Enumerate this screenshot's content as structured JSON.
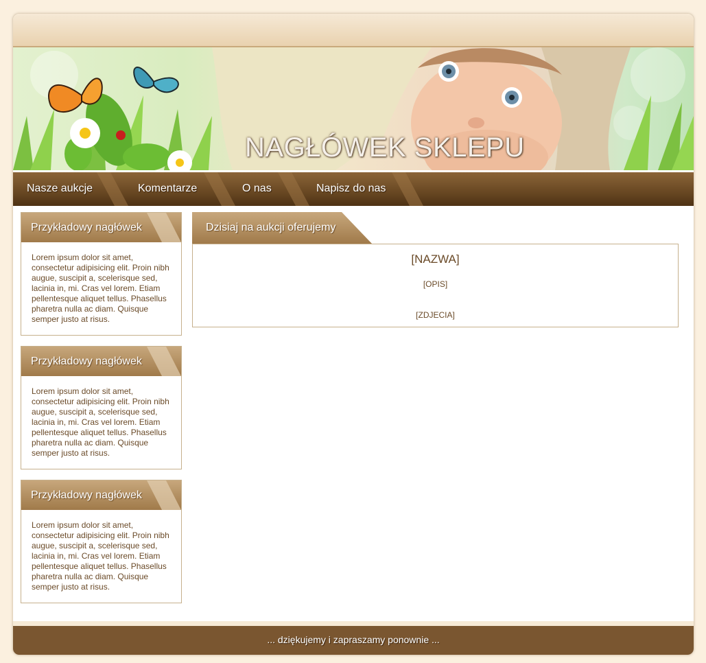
{
  "banner": {
    "title": "NAGŁÓWEK SKLEPU"
  },
  "nav": {
    "items": [
      {
        "label": "Nasze aukcje"
      },
      {
        "label": "Komentarze"
      },
      {
        "label": "O nas"
      },
      {
        "label": "Napisz do nas"
      }
    ]
  },
  "sidebar": {
    "boxes": [
      {
        "heading": "Przykładowy nagłówek",
        "text": "Lorem ipsum dolor sit amet, consectetur adipisicing elit. Proin nibh augue, suscipit a, scelerisque sed, lacinia in, mi. Cras vel lorem. Etiam pellentesque aliquet tellus. Phasellus pharetra nulla ac diam. Quisque semper justo at risus."
      },
      {
        "heading": "Przykładowy nagłówek",
        "text": "Lorem ipsum dolor sit amet, consectetur adipisicing elit. Proin nibh augue, suscipit a, scelerisque sed, lacinia in, mi. Cras vel lorem. Etiam pellentesque aliquet tellus. Phasellus pharetra nulla ac diam. Quisque semper justo at risus."
      },
      {
        "heading": "Przykładowy nagłówek",
        "text": "Lorem ipsum dolor sit amet, consectetur adipisicing elit. Proin nibh augue, suscipit a, scelerisque sed, lacinia in, mi. Cras vel lorem. Etiam pellentesque aliquet tellus. Phasellus pharetra nulla ac diam. Quisque semper justo at risus."
      }
    ]
  },
  "main": {
    "tab_label": "Dzisiaj na aukcji oferujemy",
    "name": "[NAZWA]",
    "description": "[OPIS]",
    "photos": "[ZDJECIA]"
  },
  "footer": {
    "text": "... dziękujemy i zapraszamy ponownie ..."
  },
  "colors": {
    "page_background": "#fbf0df",
    "nav_brown": "#6b4a24",
    "heading_tan": "#a07a4a",
    "footer_brown": "#7a5630",
    "text_brown": "#6a4a28"
  }
}
